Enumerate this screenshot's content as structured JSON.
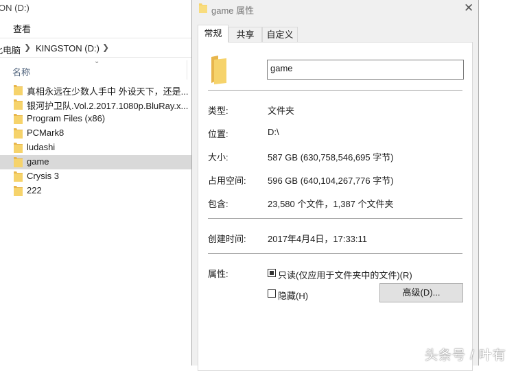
{
  "explorer": {
    "window_title": "ON (D:)",
    "ribbon": {
      "view_label": "查看"
    },
    "address": {
      "crumb1": "此电脑",
      "crumb2": "KINGSTON (D:)"
    },
    "column_name": "名称",
    "files": [
      {
        "name": "真相永远在少数人手中 外设天下，还是..."
      },
      {
        "name": "银河护卫队.Vol.2.2017.1080p.BluRay.x..."
      },
      {
        "name": "Program Files (x86)"
      },
      {
        "name": "PCMark8"
      },
      {
        "name": "ludashi"
      },
      {
        "name": "game"
      },
      {
        "name": "Crysis 3"
      },
      {
        "name": "222"
      }
    ],
    "selected_index": 5
  },
  "dialog": {
    "title": "game 属性",
    "tabs": [
      {
        "label": "常规"
      },
      {
        "label": "共享"
      },
      {
        "label": "自定义"
      }
    ],
    "active_tab": 0,
    "name_value": "game",
    "props": {
      "type_label": "类型:",
      "type_value": "文件夹",
      "location_label": "位置:",
      "location_value": "D:\\",
      "size_label": "大小:",
      "size_value": "587 GB (630,758,546,695 字节)",
      "disk_label": "占用空间:",
      "disk_value": "596 GB (640,104,267,776 字节)",
      "contains_label": "包含:",
      "contains_value": "23,580 个文件，1,387 个文件夹",
      "created_label": "创建时间:",
      "created_value": "2017年4月4日，17:33:11",
      "attributes_label": "属性:"
    },
    "attributes": {
      "readonly_label": "只读(仅应用于文件夹中的文件)(R)",
      "readonly_checked": true,
      "hidden_label": "隐藏(H)",
      "hidden_checked": false
    },
    "advanced_label": "高级(D)..."
  },
  "watermark": "头条号 / 叶有",
  "colors": {
    "folder": "#f6d36b",
    "folder_dark": "#e8b64c",
    "selection": "#d9d9d9"
  },
  "icons": {
    "folder": "folder-icon",
    "close": "close-icon",
    "chevron": "chevron-right-icon"
  }
}
